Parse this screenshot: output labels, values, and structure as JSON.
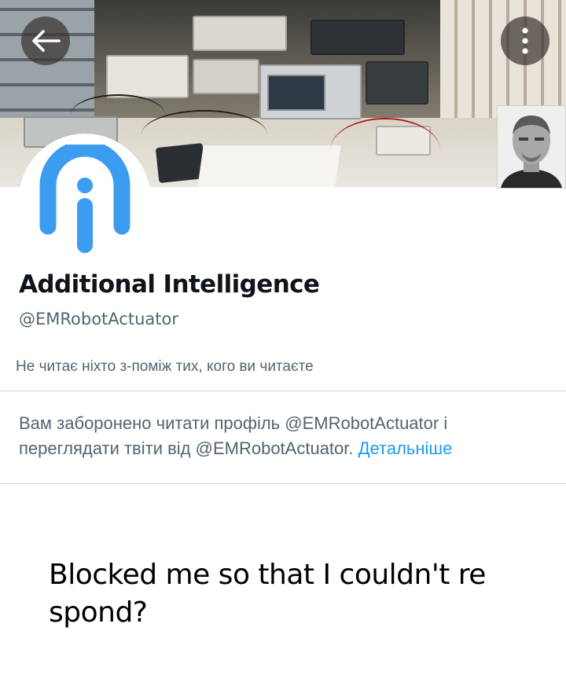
{
  "header": {
    "back_icon": "arrow-left-icon",
    "more_icon": "more-vertical-icon",
    "banner_description_icon": "electronics-lab-banner"
  },
  "profile": {
    "avatar_icon": "info-i-logo-icon",
    "avatar_color": "#3b9cf0",
    "name": "Additional Intelligence",
    "handle": "@EMRobotActuator",
    "followers_note": "Не читає ніхто з-поміж тих, кого ви читаєте"
  },
  "blocked_notice": {
    "text_line1": "Вам заборонено читати профіль @EMRobotActuator і",
    "text_line2": "переглядати твіти від @EMRobotActuator. ",
    "link_label": "Детальніше",
    "link_color": "#1d9bf0"
  },
  "caption": {
    "line1": "Blocked me so that I couldn't re",
    "line2": "spond?"
  }
}
